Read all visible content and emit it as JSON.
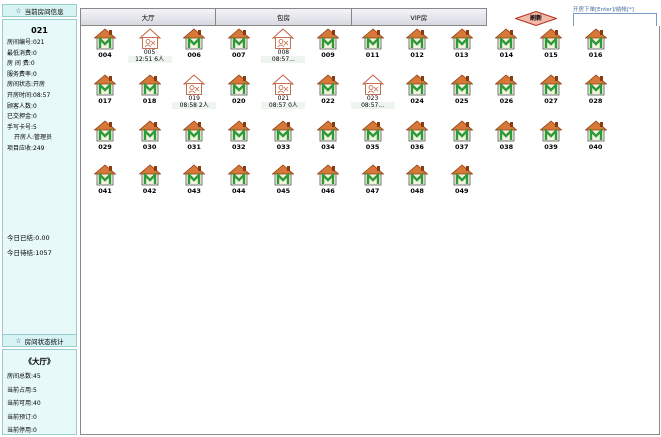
{
  "left_panel": {
    "current_title": "当前房间信息",
    "room_id": "021",
    "rows": [
      {
        "text": "房间编号:021",
        "indent": false
      },
      {
        "text": "最低消费:0",
        "indent": false
      },
      {
        "text": "房 间 费:0",
        "indent": false
      },
      {
        "text": "服务费率:0",
        "indent": false
      },
      {
        "text": "房间状态:开房",
        "indent": false
      },
      {
        "text": "开房时间:08:57",
        "indent": false
      },
      {
        "text": "顾客人数:0",
        "indent": false
      },
      {
        "text": "已交押金:0",
        "indent": false
      },
      {
        "text": "手写卡号:5",
        "indent": false
      },
      {
        "text": "开房人:管理员",
        "indent": true
      },
      {
        "text": "项目应收:249",
        "indent": false
      }
    ],
    "today_paid": "今日已结:0.00",
    "today_unpaid": "今日待结:1057",
    "stats_title": "房间状态统计",
    "stats_area": "《大厅》",
    "stats_rows": [
      "房间总数:45",
      "当前占用:5",
      "当前可用:40",
      "当前预订:0",
      "当前停用:0"
    ]
  },
  "tabs": [
    "大厅",
    "包房",
    "VIP房"
  ],
  "refresh_label": "刷新",
  "open_room_label": "开房下单[Enter]/结帐[*]",
  "open_room_value": "",
  "colors": {
    "roof": "#d87838",
    "wall": "#f3f3e0",
    "door": "#2e9a3a",
    "panel_bg": "#e7f9f9",
    "refresh_fill": "#f4b8a8"
  },
  "rooms": [
    {
      "num": "004",
      "status": "free"
    },
    {
      "num": "005",
      "status": "occupied",
      "info": "12:51 6人"
    },
    {
      "num": "006",
      "status": "free"
    },
    {
      "num": "007",
      "status": "free"
    },
    {
      "num": "008",
      "status": "occupied",
      "info": "08:57..."
    },
    {
      "num": "009",
      "status": "free"
    },
    {
      "num": "011",
      "status": "free"
    },
    {
      "num": "012",
      "status": "free"
    },
    {
      "num": "013",
      "status": "free"
    },
    {
      "num": "014",
      "status": "free"
    },
    {
      "num": "015",
      "status": "free"
    },
    {
      "num": "016",
      "status": "free"
    },
    {
      "num": "017",
      "status": "free"
    },
    {
      "num": "018",
      "status": "free"
    },
    {
      "num": "019",
      "status": "occupied",
      "info": "08:58 2人"
    },
    {
      "num": "020",
      "status": "free"
    },
    {
      "num": "021",
      "status": "occupied",
      "info": "08:57 0人"
    },
    {
      "num": "022",
      "status": "free"
    },
    {
      "num": "023",
      "status": "occupied",
      "info": "08:57..."
    },
    {
      "num": "024",
      "status": "free"
    },
    {
      "num": "025",
      "status": "free"
    },
    {
      "num": "026",
      "status": "free"
    },
    {
      "num": "027",
      "status": "free"
    },
    {
      "num": "028",
      "status": "free"
    },
    {
      "num": "029",
      "status": "free"
    },
    {
      "num": "030",
      "status": "free"
    },
    {
      "num": "031",
      "status": "free"
    },
    {
      "num": "032",
      "status": "free"
    },
    {
      "num": "033",
      "status": "free"
    },
    {
      "num": "034",
      "status": "free"
    },
    {
      "num": "035",
      "status": "free"
    },
    {
      "num": "036",
      "status": "free"
    },
    {
      "num": "037",
      "status": "free"
    },
    {
      "num": "038",
      "status": "free"
    },
    {
      "num": "039",
      "status": "free"
    },
    {
      "num": "040",
      "status": "free"
    },
    {
      "num": "041",
      "status": "free"
    },
    {
      "num": "042",
      "status": "free"
    },
    {
      "num": "043",
      "status": "free"
    },
    {
      "num": "044",
      "status": "free"
    },
    {
      "num": "045",
      "status": "free"
    },
    {
      "num": "046",
      "status": "free"
    },
    {
      "num": "047",
      "status": "free"
    },
    {
      "num": "048",
      "status": "free"
    },
    {
      "num": "049",
      "status": "free"
    }
  ]
}
